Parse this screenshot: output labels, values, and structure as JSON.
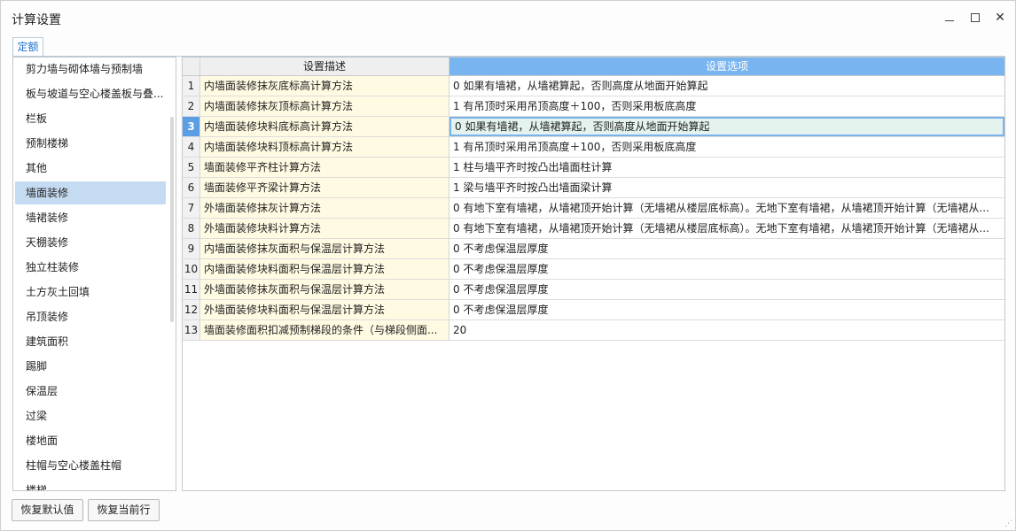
{
  "window": {
    "title": "计算设置"
  },
  "tabs": [
    {
      "label": "定额"
    }
  ],
  "sidebar": {
    "active_index": 5,
    "items": [
      {
        "label": "剪力墙与砌体墙与预制墙"
      },
      {
        "label": "板与坡道与空心楼盖板与叠..."
      },
      {
        "label": "栏板"
      },
      {
        "label": "预制楼梯"
      },
      {
        "label": "其他"
      },
      {
        "label": "墙面装修"
      },
      {
        "label": "墙裙装修"
      },
      {
        "label": "天棚装修"
      },
      {
        "label": "独立柱装修"
      },
      {
        "label": "土方灰土回填"
      },
      {
        "label": "吊顶装修"
      },
      {
        "label": "建筑面积"
      },
      {
        "label": "踢脚"
      },
      {
        "label": "保温层"
      },
      {
        "label": "过梁"
      },
      {
        "label": "楼地面"
      },
      {
        "label": "柱帽与空心楼盖柱帽"
      },
      {
        "label": "楼梯"
      }
    ]
  },
  "grid": {
    "header": {
      "desc": "设置描述",
      "option": "设置选项"
    },
    "selected_row": 3,
    "rows": [
      {
        "num": "1",
        "desc": "内墙面装修抹灰底标高计算方法",
        "option": "0 如果有墙裙，从墙裙算起，否则高度从地面开始算起"
      },
      {
        "num": "2",
        "desc": "内墙面装修抹灰顶标高计算方法",
        "option": "1 有吊顶时采用吊顶高度＋100，否则采用板底高度"
      },
      {
        "num": "3",
        "desc": "内墙面装修块料底标高计算方法",
        "option": "0 如果有墙裙，从墙裙算起，否则高度从地面开始算起"
      },
      {
        "num": "4",
        "desc": "内墙面装修块料顶标高计算方法",
        "option": "1 有吊顶时采用吊顶高度＋100，否则采用板底高度"
      },
      {
        "num": "5",
        "desc": "墙面装修平齐柱计算方法",
        "option": "1 柱与墙平齐时按凸出墙面柱计算"
      },
      {
        "num": "6",
        "desc": "墙面装修平齐梁计算方法",
        "option": "1 梁与墙平齐时按凸出墙面梁计算"
      },
      {
        "num": "7",
        "desc": "外墙面装修抹灰计算方法",
        "option": "0 有地下室有墙裙，从墙裙顶开始计算（无墙裙从楼层底标高）。无地下室有墙裙，从墙裙顶开始计算（无墙裙从..."
      },
      {
        "num": "8",
        "desc": "外墙面装修块料计算方法",
        "option": "0 有地下室有墙裙，从墙裙顶开始计算（无墙裙从楼层底标高）。无地下室有墙裙，从墙裙顶开始计算（无墙裙从..."
      },
      {
        "num": "9",
        "desc": "内墙面装修抹灰面积与保温层计算方法",
        "option": "0 不考虑保温层厚度"
      },
      {
        "num": "10",
        "desc": "内墙面装修块料面积与保温层计算方法",
        "option": "0 不考虑保温层厚度"
      },
      {
        "num": "11",
        "desc": "外墙面装修抹灰面积与保温层计算方法",
        "option": "0 不考虑保温层厚度"
      },
      {
        "num": "12",
        "desc": "外墙面装修块料面积与保温层计算方法",
        "option": "0 不考虑保温层厚度"
      },
      {
        "num": "13",
        "desc": "墙面装修面积扣减预制梯段的条件（与梯段侧面...",
        "option": "20"
      }
    ]
  },
  "buttons": {
    "restore_default": "恢复默认值",
    "restore_current": "恢复当前行"
  },
  "colors": {
    "accent": "#78b5f0",
    "selected_sidebar": "#c5dbf2",
    "desc_bg": "#fffbe3",
    "selected_row_bg": "#e4f3ee"
  }
}
